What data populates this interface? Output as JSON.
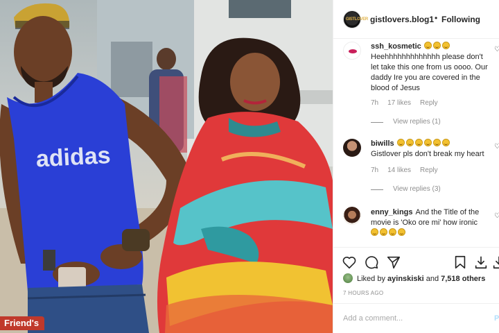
{
  "photo": {
    "watermark": "Friend's",
    "shirt_text": "adidas"
  },
  "header": {
    "username": "gistlovers.blog1",
    "separator": "•",
    "follow_label": "Following",
    "avatar_icon": "profile-logo-icon"
  },
  "comments": [
    {
      "username": "ssh_kosmetic",
      "emojis": 3,
      "text": "Heehhhhhhhhhhhhh please don't let take this one from us oooo. Our daddy Ire you are covered in the blood of Jesus",
      "time": "7h",
      "likes": "17 likes",
      "reply_label": "Reply",
      "view_replies": "View replies (1)"
    },
    {
      "username": "biwills",
      "emojis": 6,
      "text": "Gistlover pls don't break my heart",
      "time": "7h",
      "likes": "14 likes",
      "reply_label": "Reply",
      "view_replies": "View replies (3)"
    },
    {
      "username": "enny_kings",
      "text": "And the Title of the movie is 'Oko ore mi' how ironic",
      "emojis": 4
    }
  ],
  "actions": {
    "like_icon": "heart-icon",
    "comment_icon": "comment-icon",
    "share_icon": "paper-plane-icon",
    "save_icon": "bookmark-icon"
  },
  "likes": {
    "prefix": "Liked by",
    "user": "ayinskiski",
    "connector": "and",
    "count": "7,518 others"
  },
  "timestamp": "7 HOURS AGO",
  "add_comment": {
    "placeholder": "Add a comment...",
    "post_label": "P"
  },
  "colors": {
    "text": "#262626",
    "muted": "#8e8e8e",
    "border": "#efefef",
    "watermark_bg": "#c0392b",
    "shirt_blue": "#2a3fd6"
  }
}
